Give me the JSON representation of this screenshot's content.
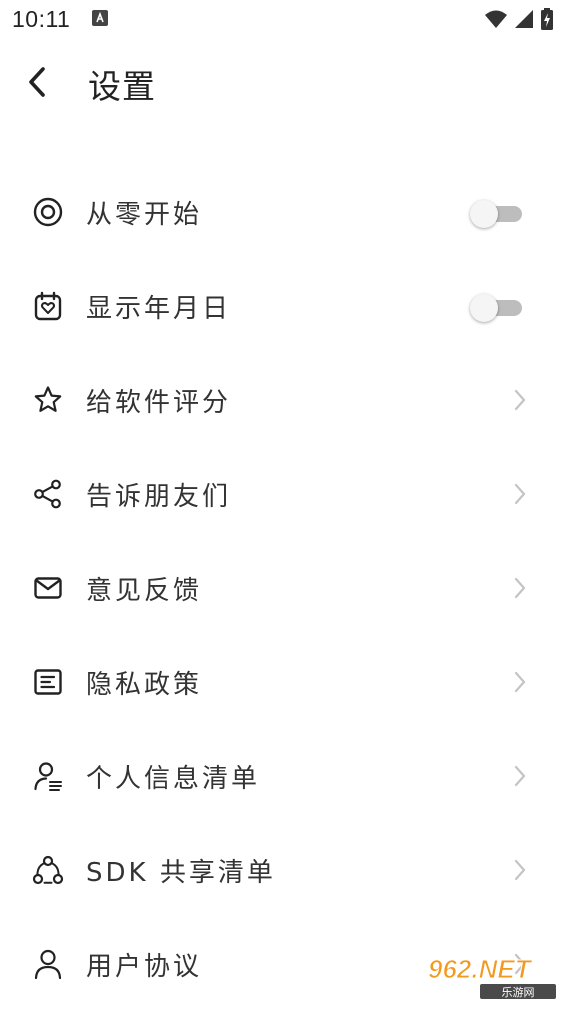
{
  "status_bar": {
    "time": "10:11"
  },
  "header": {
    "title": "设置"
  },
  "settings": [
    {
      "label": "从零开始",
      "icon": "target-icon",
      "control": "toggle",
      "enabled": false
    },
    {
      "label": "显示年月日",
      "icon": "calendar-heart-icon",
      "control": "toggle",
      "enabled": false
    },
    {
      "label": "给软件评分",
      "icon": "star-icon",
      "control": "chevron"
    },
    {
      "label": "告诉朋友们",
      "icon": "share-icon",
      "control": "chevron"
    },
    {
      "label": "意见反馈",
      "icon": "mail-icon",
      "control": "chevron"
    },
    {
      "label": "隐私政策",
      "icon": "document-icon",
      "control": "chevron"
    },
    {
      "label": "个人信息清单",
      "icon": "user-list-icon",
      "control": "chevron"
    },
    {
      "label": "SDK 共享清单",
      "icon": "network-icon",
      "control": "chevron"
    },
    {
      "label": "用户协议",
      "icon": "user-icon",
      "control": "chevron"
    }
  ],
  "watermark": {
    "top_text": "962.NET",
    "bottom_text": "乐游网"
  },
  "colors": {
    "text": "#333333",
    "icon": "#222222",
    "chevron": "#c4c4c4",
    "toggle_track_off": "#bdbdbd",
    "toggle_thumb_off": "#f5f5f5",
    "watermark_orange": "#f39a1e"
  }
}
